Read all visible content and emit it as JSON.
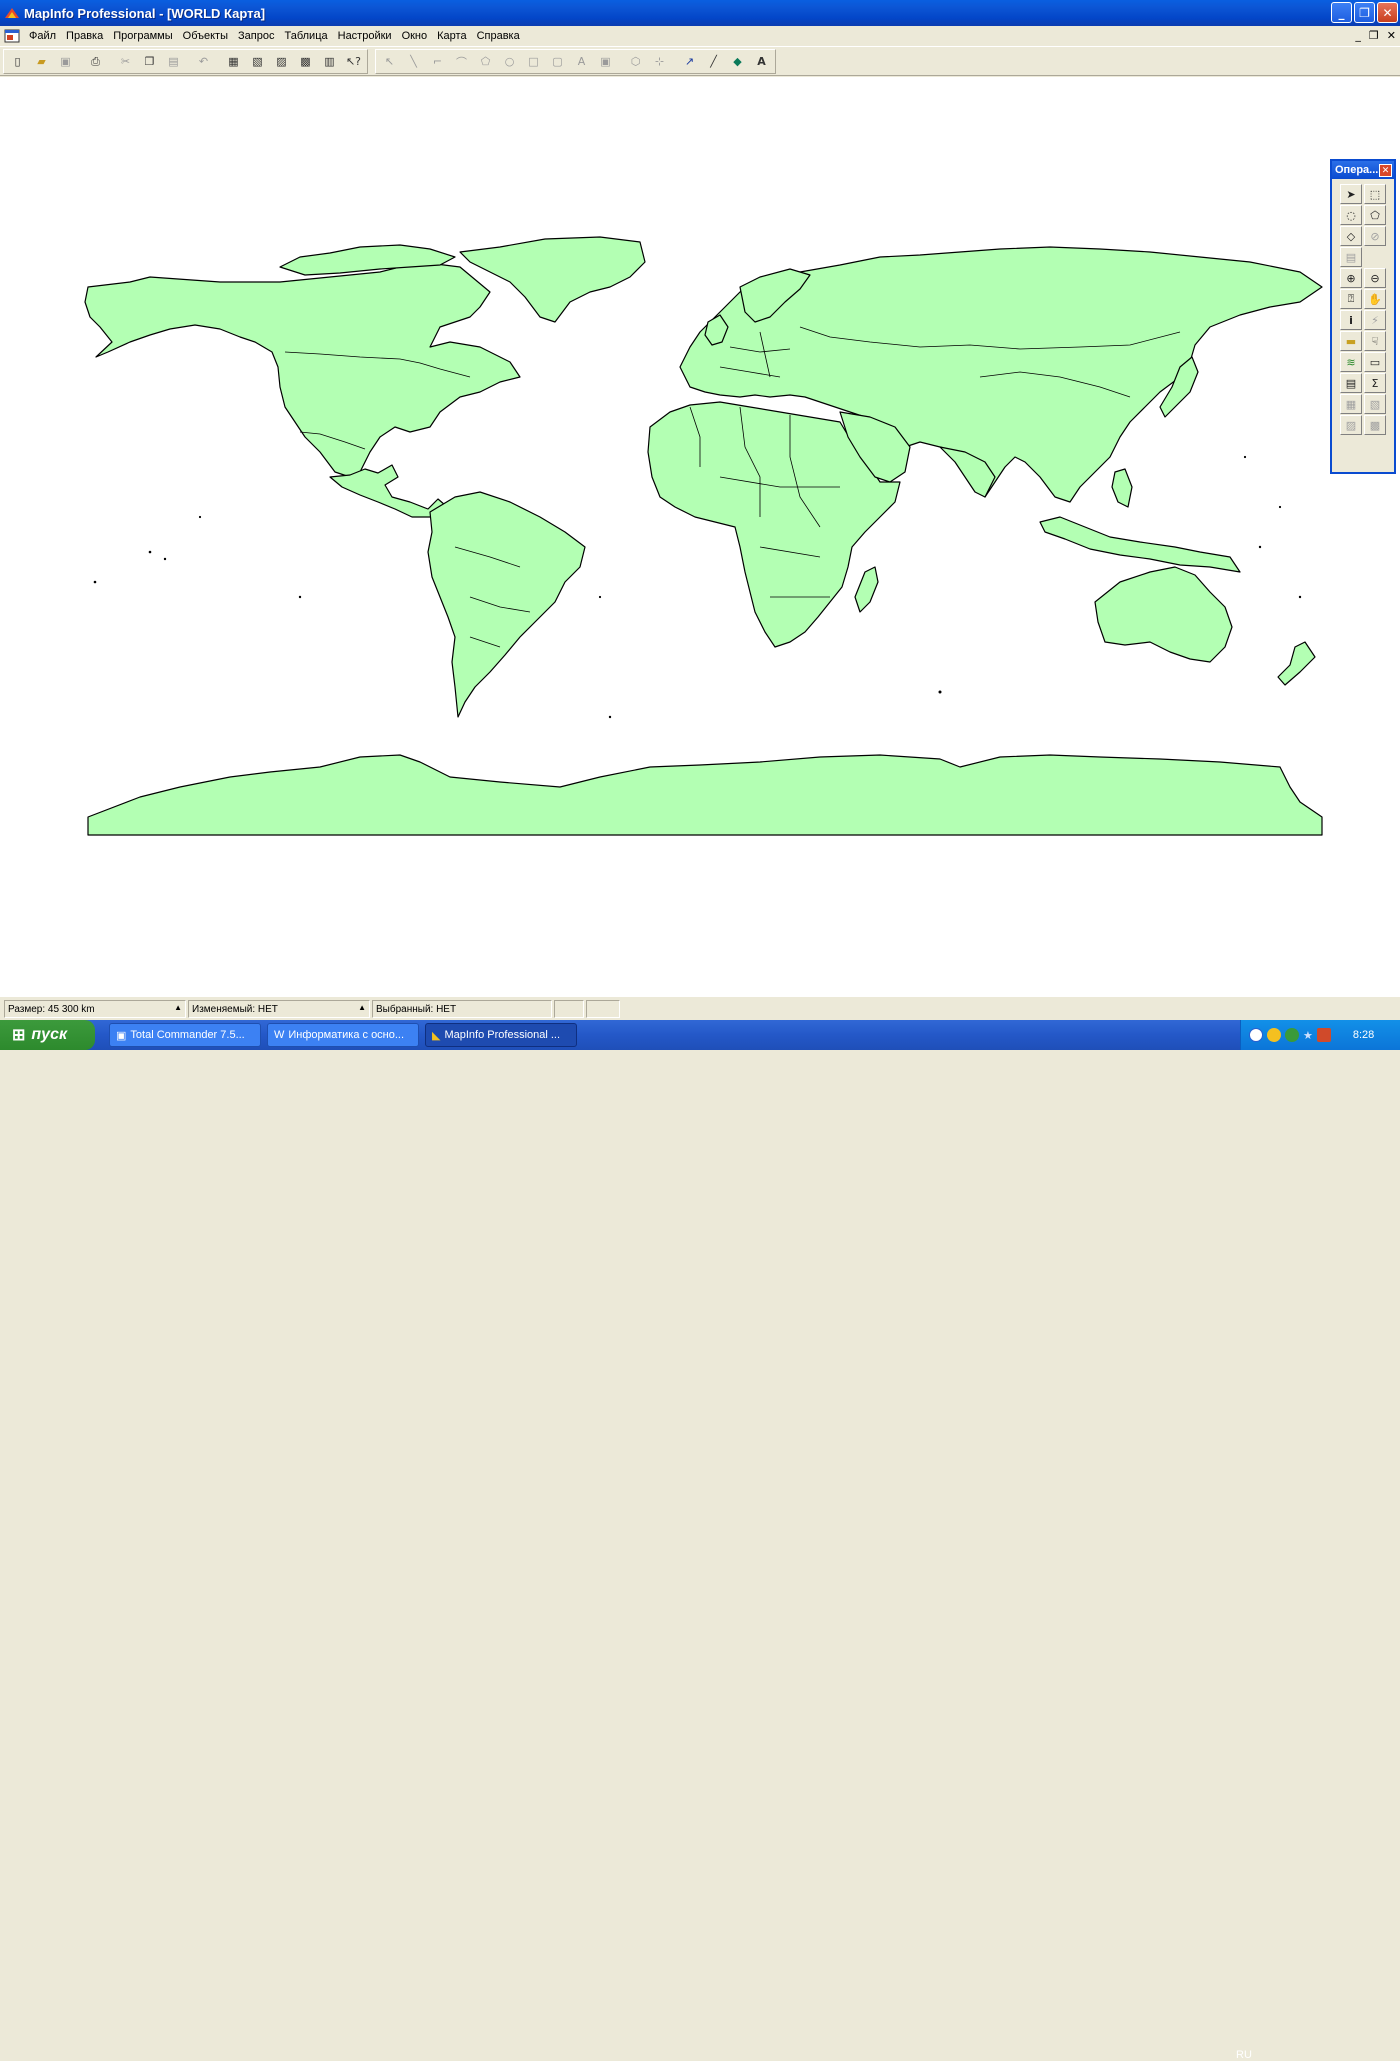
{
  "window": {
    "title": "MapInfo Professional - [WORLD Карта]",
    "minimize": "_",
    "maximize": "❐",
    "close": "✕"
  },
  "menu": {
    "items": [
      "Файл",
      "Правка",
      "Программы",
      "Объекты",
      "Запрос",
      "Таблица",
      "Настройки",
      "Окно",
      "Карта",
      "Справка"
    ],
    "mdi_minimize": "_",
    "mdi_restore": "❐",
    "mdi_close": "✕"
  },
  "toolbar": {
    "icons": [
      "new-icon",
      "open-icon",
      "save-icon",
      "print-icon",
      "cut-icon",
      "copy-icon",
      "paste-icon",
      "undo-icon",
      "browser-icon",
      "map-icon",
      "graph-icon",
      "layout-icon",
      "redistrict-icon",
      "help-pointer-icon",
      "symbol-icon",
      "line-icon",
      "polyline-icon",
      "arc-icon",
      "polygon-icon",
      "ellipse-icon",
      "rectangle-icon",
      "rounded-rect-icon",
      "text-icon",
      "frame-icon",
      "reshape-icon",
      "add-node-icon",
      "line-style-icon",
      "region-style-icon",
      "symbol-style-icon",
      "text-style-icon"
    ]
  },
  "palette": {
    "title": "Опера...",
    "close": "✕"
  },
  "map": {
    "land_color": "#b3ffb3",
    "outline_color": "#000000"
  },
  "status": {
    "zoom": "Размер: 45 300 km",
    "editable": "Изменяемый: НЕТ",
    "selected": "Выбранный: НЕТ"
  },
  "taskbar": {
    "start": "пуск",
    "tasks": [
      "Total Commander 7.5...",
      "Информатика с осно...",
      "MapInfo Professional ..."
    ],
    "language": "RU",
    "clock": "8:28"
  }
}
